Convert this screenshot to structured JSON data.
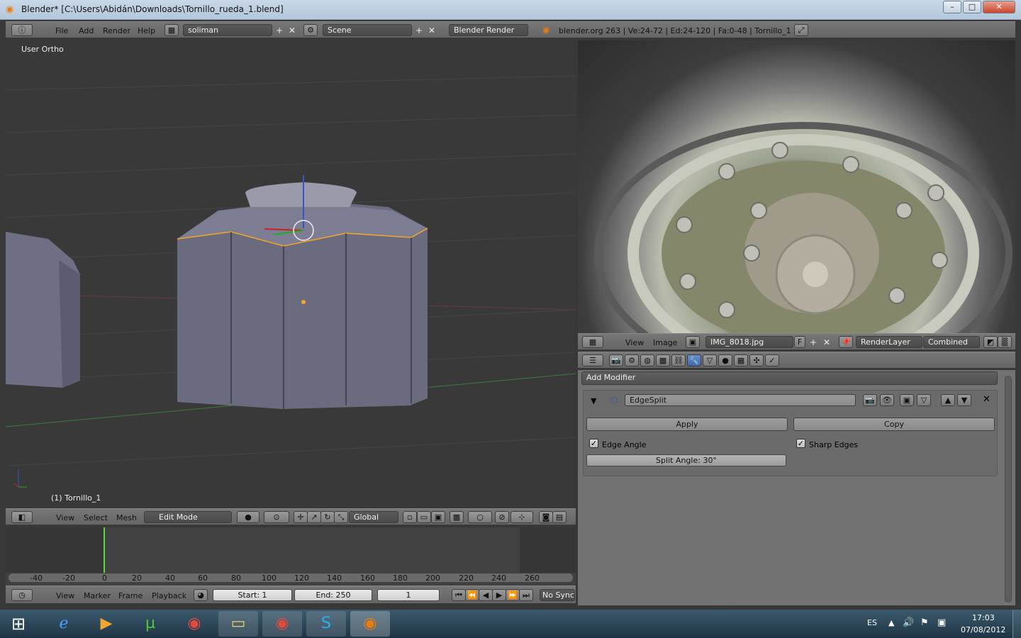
{
  "window": {
    "title": "Blender* [C:\\Users\\Abidán\\Downloads\\Tornillo_rueda_1.blend]",
    "min": "–",
    "max": "□",
    "close": "✕"
  },
  "info_header": {
    "menus": [
      "File",
      "Add",
      "Render",
      "Help"
    ],
    "screen": "soliman",
    "scene": "Scene",
    "engine": "Blender Render",
    "stats": "blender.org 263 | Ve:24-72 | Ed:24-120 | Fa:0-48 | Tornillo_1"
  },
  "viewport": {
    "view_name": "User Ortho",
    "object_label": "(1) Tornillo_1"
  },
  "view3d_header": {
    "menus": [
      "View",
      "Select",
      "Mesh"
    ],
    "mode": "Edit Mode",
    "orientation": "Global"
  },
  "timeline": {
    "ticks": [
      "-40",
      "-20",
      "0",
      "20",
      "40",
      "60",
      "80",
      "100",
      "120",
      "140",
      "160",
      "180",
      "200",
      "220",
      "240",
      "260"
    ],
    "menus": [
      "View",
      "Marker",
      "Frame",
      "Playback"
    ],
    "start": "Start: 1",
    "end": "End: 250",
    "current": "1",
    "sync": "No Sync"
  },
  "image_editor_header": {
    "menus": [
      "View",
      "Image"
    ],
    "image": "IMG_8018.jpg",
    "fake": "F",
    "layer": "RenderLayer",
    "pass": "Combined"
  },
  "properties": {
    "add_modifier": "Add Modifier",
    "modifier_name": "EdgeSplit",
    "apply": "Apply",
    "copy": "Copy",
    "edge_angle": "Edge Angle",
    "sharp_edges": "Sharp Edges",
    "split_angle": "Split Angle: 30°"
  },
  "taskbar": {
    "lang": "ES",
    "time": "17:03",
    "date": "07/08/2012"
  },
  "colors": {
    "selection": "#f5a623",
    "axis_x": "#d33",
    "axis_y": "#3c3",
    "axis_z": "#33c"
  }
}
